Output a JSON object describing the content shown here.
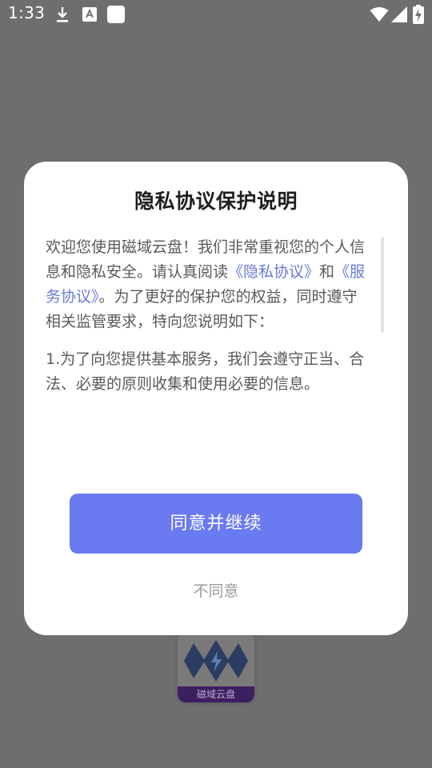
{
  "status_bar": {
    "time": "1:33",
    "icons": [
      "download-icon",
      "text-a-icon",
      "square-icon",
      "wifi-icon",
      "signal-icon",
      "battery-charging-icon"
    ]
  },
  "background_app": {
    "logo_text": "磁域云盘"
  },
  "dialog": {
    "title": "隐私协议保护说明",
    "paragraph1": {
      "text_before": "欢迎您使用磁域云盘！我们非常重视您的个人信息和隐私安全。请认真阅读",
      "link_privacy": "《隐私协议》",
      "text_and": "和",
      "link_service": "《服务协议》",
      "text_after": "。为了更好的保护您的权益，同时遵守相关监管要求，特向您说明如下："
    },
    "paragraph2": "1.为了向您提供基本服务，我们会遵守正当、合法、必要的原则收集和使用必要的信息。",
    "agree_label": "同意并继续",
    "disagree_label": "不同意"
  },
  "colors": {
    "overlay": "#6e6e6e",
    "accent": "#6a7af0",
    "link": "#6a7ad8",
    "body_text": "#5a5a5a",
    "title_text": "#1f1f1f",
    "muted_text": "#9a9a9a"
  }
}
